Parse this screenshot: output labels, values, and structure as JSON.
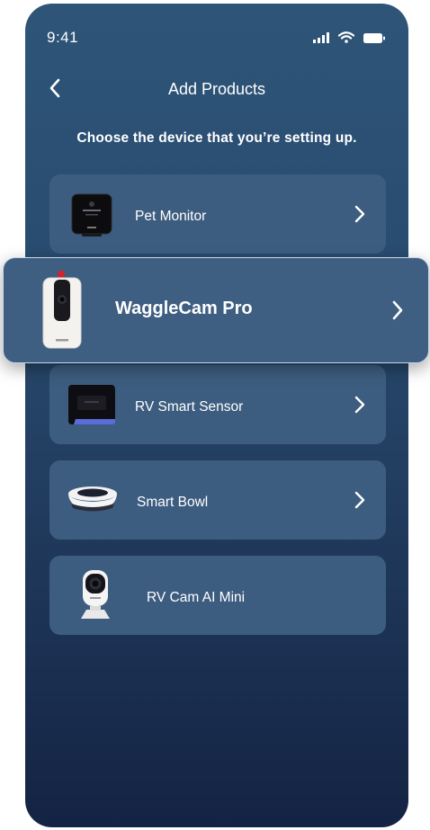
{
  "status_bar": {
    "time": "9:41"
  },
  "nav": {
    "title": "Add Products"
  },
  "subtitle": "Choose the device that you’re setting up.",
  "products": [
    {
      "label": "Pet Monitor",
      "icon": "pet-monitor-device-image",
      "has_chevron": true
    },
    {
      "label": "WaggleCam Pro",
      "icon": "wagglecam-pro-device-image",
      "has_chevron": true,
      "highlighted": true
    },
    {
      "label": "RV Smart Sensor",
      "icon": "rv-smart-sensor-device-image",
      "has_chevron": true
    },
    {
      "label": "Smart Bowl",
      "icon": "smart-bowl-device-image",
      "has_chevron": true
    },
    {
      "label": "RV Cam AI Mini",
      "icon": "rv-cam-ai-mini-device-image",
      "has_chevron": false
    }
  ],
  "colors": {
    "background_top": "#2e5578",
    "background_bottom": "#142343",
    "card": "#3d5d80",
    "text": "#ffffff"
  }
}
